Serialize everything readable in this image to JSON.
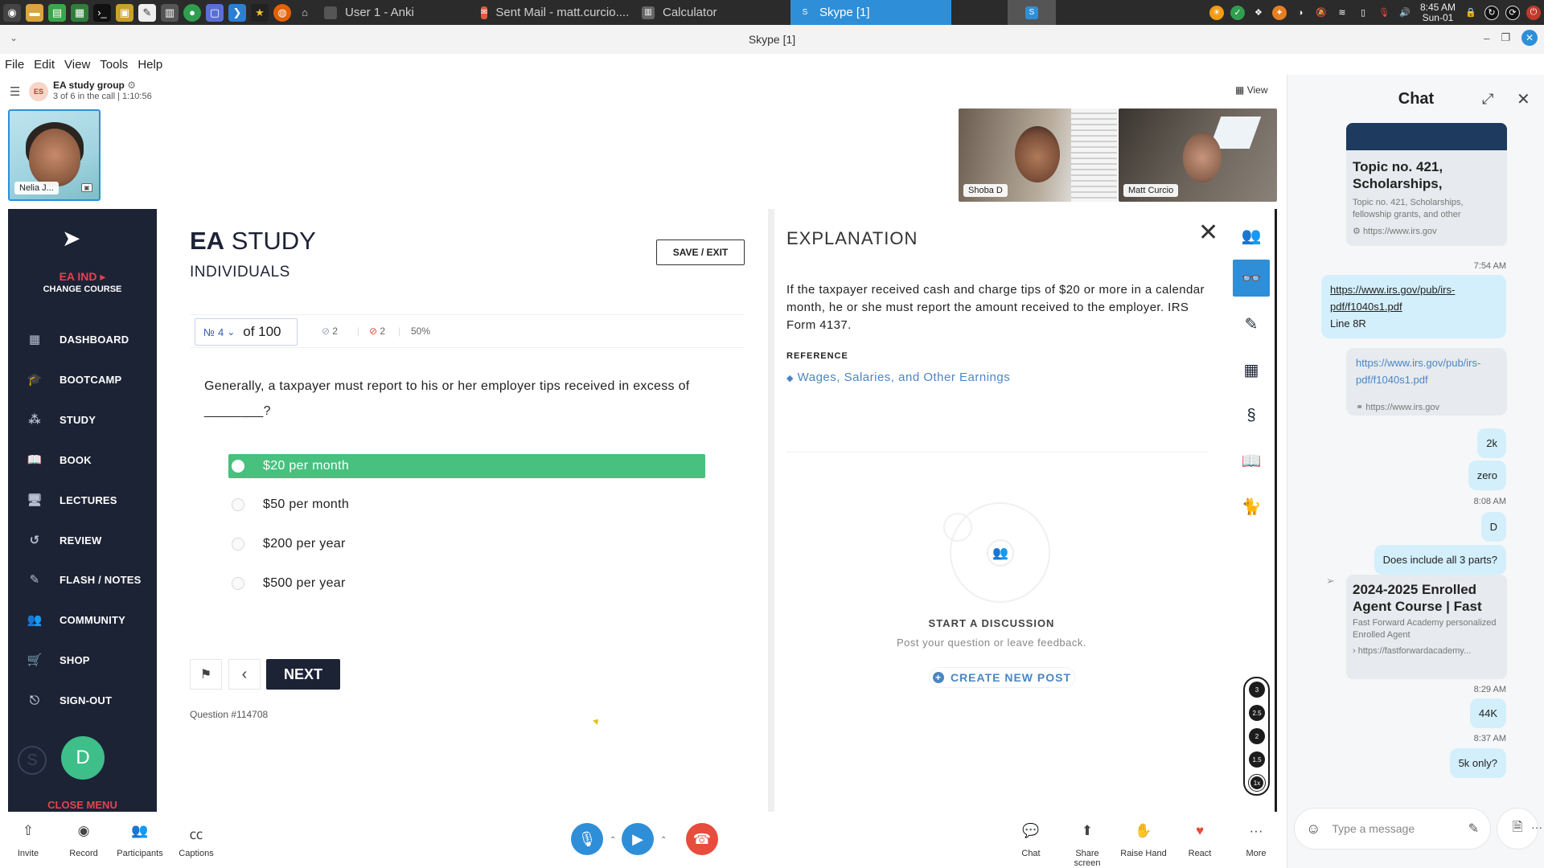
{
  "taskbar": {
    "tasks": [
      {
        "label": "User 1 - Anki",
        "icon": "anki-icon",
        "color": "#555555"
      },
      {
        "label": "Sent Mail - matt.curcio....",
        "icon": "mail-icon",
        "color": "#e2593e"
      },
      {
        "label": "Calculator",
        "icon": "calculator-icon",
        "color": "#666666"
      },
      {
        "label": "Skype [1]",
        "icon": "skype-icon",
        "color": "#2e8fd8"
      }
    ],
    "clock_time": "8:45 AM",
    "clock_date": "Sun-01"
  },
  "window": {
    "title": "Skype [1]",
    "menu": [
      "File",
      "Edit",
      "View",
      "Tools",
      "Help"
    ]
  },
  "call": {
    "group_initials": "ES",
    "group_name": "EA study group",
    "status": "3 of 6 in the call | 1:10:56",
    "view_label": "View",
    "self_name": "Nelia J...",
    "participants": [
      "Shoba D",
      "Matt Curcio"
    ]
  },
  "course": {
    "course_name": "EA IND ▸",
    "change_course": "CHANGE COURSE",
    "nav": [
      {
        "label": "DASHBOARD",
        "icon": "dashboard-icon",
        "glyph": "▦"
      },
      {
        "label": "BOOTCAMP",
        "icon": "graduation-cap-icon",
        "glyph": "🎓"
      },
      {
        "label": "STUDY",
        "icon": "study-icon",
        "glyph": "⁂"
      },
      {
        "label": "BOOK",
        "icon": "book-icon",
        "glyph": "📖"
      },
      {
        "label": "LECTURES",
        "icon": "lectures-icon",
        "glyph": "🖥"
      },
      {
        "label": "REVIEW",
        "icon": "review-icon",
        "glyph": "↺"
      },
      {
        "label": "FLASH / NOTES",
        "icon": "flash-notes-icon",
        "glyph": "✎"
      },
      {
        "label": "COMMUNITY",
        "icon": "community-icon",
        "glyph": "👥"
      },
      {
        "label": "SHOP",
        "icon": "shop-cart-icon",
        "glyph": "🛒"
      },
      {
        "label": "SIGN-OUT",
        "icon": "sign-out-icon",
        "glyph": "⎋"
      }
    ],
    "user_initial": "D",
    "close_menu": "CLOSE MENU"
  },
  "study": {
    "title_bold": "EA",
    "title_rest": "STUDY",
    "subtitle": "INDIVIDUALS",
    "save_exit": "SAVE / EXIT",
    "question_no_prefix": "№",
    "question_no": "4",
    "question_total": "of 100",
    "correct_count": "2",
    "wrong_count": "2",
    "percent": "50%",
    "question": "Generally, a taxpayer must report to his or her employer tips received in excess of ________?",
    "options": [
      {
        "label": "$20 per month",
        "correct": true
      },
      {
        "label": "$50 per month",
        "correct": false
      },
      {
        "label": "$200 per year",
        "correct": false
      },
      {
        "label": "$500 per year",
        "correct": false
      }
    ],
    "next_label": "NEXT",
    "question_id": "Question #114708"
  },
  "explanation": {
    "title": "EXPLANATION",
    "body": "If the taxpayer received cash and charge tips of $20 or more in a calendar month, he or she must report the amount received to the employer. IRS Form 4137.",
    "reference_label": "REFERENCE",
    "reference_link": "Wages, Salaries, and Other Earnings",
    "start_discussion": "START A DISCUSSION",
    "post_prompt": "Post your question or leave feedback.",
    "create_post": "CREATE NEW POST"
  },
  "speed_options": [
    "3",
    "2.5",
    "2",
    "1.5",
    "1x"
  ],
  "callbar": {
    "invite": "Invite",
    "record": "Record",
    "participants": "Participants",
    "captions": "Captions",
    "chat": "Chat",
    "share_screen": "Share screen",
    "raise_hand": "Raise Hand",
    "react": "React",
    "more": "More"
  },
  "chat": {
    "title": "Chat",
    "card1_title": "Topic no. 421, Scholarships,",
    "card1_desc": "Topic no. 421, Scholarships, fellowship grants, and other",
    "card1_src": "https://www.irs.gov",
    "ts1": "7:54 AM",
    "msg_link": "https://www.irs.gov/pub/irs-pdf/f1040s1.pdf",
    "msg_line": "Line 8R",
    "card2_link": "https://www.irs.gov/pub/irs-pdf/f1040s1.pdf",
    "card2_src": "https://www.irs.gov",
    "msg_2k": "2k",
    "msg_zero": "zero",
    "ts2": "8:08 AM",
    "msg_d": "D",
    "msg_parts": "Does include all 3 parts?",
    "card3_title": "2024-2025 Enrolled Agent Course | Fast",
    "card3_desc": "Fast Forward Academy personalized Enrolled Agent",
    "card3_src": "https://fastforwardacademy...",
    "ts3": "8:29 AM",
    "msg_44k": "44K",
    "ts4": "8:37 AM",
    "msg_5k": "5k only?",
    "placeholder": "Type a message"
  }
}
